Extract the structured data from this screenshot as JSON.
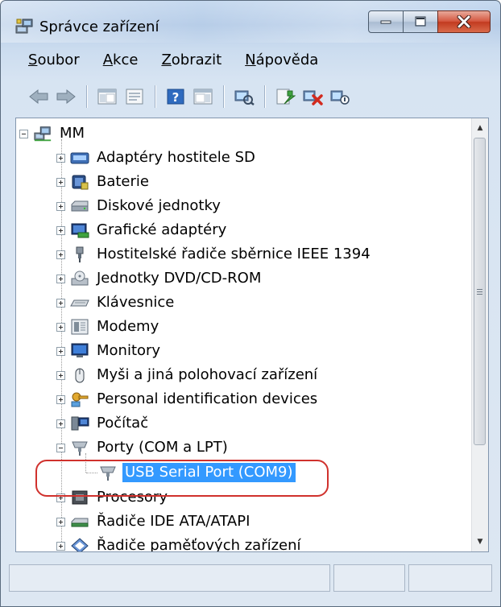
{
  "window": {
    "title": "Správce zařízení"
  },
  "menu": [
    {
      "label_u": "S",
      "label_rest": "oubor"
    },
    {
      "label_u": "A",
      "label_rest": "kce"
    },
    {
      "label_u": "Z",
      "label_rest": "obrazit"
    },
    {
      "label_u": "N",
      "label_rest": "ápověda"
    }
  ],
  "tree": {
    "root": "MM",
    "items": [
      {
        "label": "Adaptéry hostitele SD",
        "icon": "sd-host-adapter-icon"
      },
      {
        "label": "Baterie",
        "icon": "battery-icon"
      },
      {
        "label": "Diskové jednotky",
        "icon": "disk-drive-icon"
      },
      {
        "label": "Grafické adaptéry",
        "icon": "display-adapter-icon"
      },
      {
        "label": "Hostitelské řadiče sběrnice IEEE 1394",
        "icon": "ieee1394-controller-icon"
      },
      {
        "label": "Jednotky DVD/CD-ROM",
        "icon": "dvd-drive-icon"
      },
      {
        "label": "Klávesnice",
        "icon": "keyboard-icon"
      },
      {
        "label": "Modemy",
        "icon": "modem-icon"
      },
      {
        "label": "Monitory",
        "icon": "monitor-icon"
      },
      {
        "label": "Myši a jiná polohovací zařízení",
        "icon": "mouse-icon"
      },
      {
        "label": "Personal identification devices",
        "icon": "identification-device-icon"
      },
      {
        "label": "Počítač",
        "icon": "computer-icon"
      },
      {
        "label": "Porty (COM a LPT)",
        "icon": "port-icon",
        "expanded": true
      },
      {
        "label": "USB Serial Port (COM9)",
        "icon": "serial-port-icon",
        "child": true,
        "selected": true
      },
      {
        "label": "Procesory",
        "icon": "processor-icon"
      },
      {
        "label": "Řadiče IDE ATA/ATAPI",
        "icon": "ide-controller-icon"
      },
      {
        "label": "Řadiče paměťových zařízení",
        "icon": "storage-controller-icon"
      }
    ]
  },
  "colors": {
    "selection": "#3399ff",
    "annotation_ring": "#d0312d"
  }
}
